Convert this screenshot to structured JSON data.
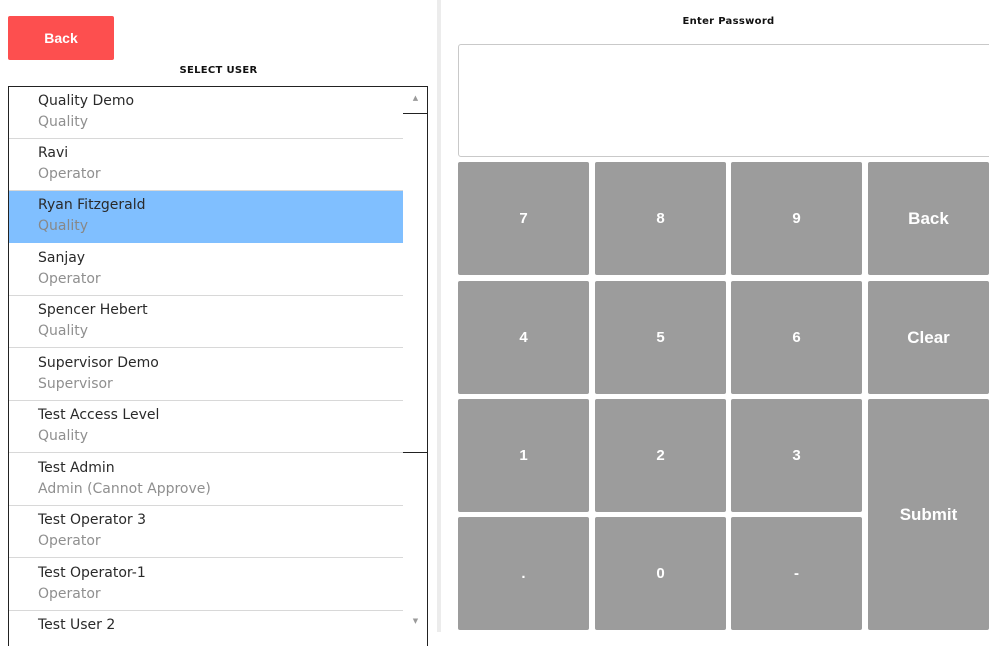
{
  "left_panel": {
    "back_label": "Back",
    "select_user_title": "SELECT USER",
    "users": [
      {
        "name": "Quality Demo",
        "role": "Quality"
      },
      {
        "name": "Ravi",
        "role": "Operator"
      },
      {
        "name": "Ryan Fitzgerald",
        "role": "Quality",
        "selected": true
      },
      {
        "name": "Sanjay",
        "role": "Operator"
      },
      {
        "name": "Spencer Hebert",
        "role": "Quality"
      },
      {
        "name": "Supervisor Demo",
        "role": "Supervisor"
      },
      {
        "name": "Test Access Level",
        "role": "Quality"
      },
      {
        "name": "Test Admin",
        "role": "Admin (Cannot Approve)"
      },
      {
        "name": "Test Operator 3",
        "role": "Operator"
      },
      {
        "name": "Test Operator-1",
        "role": "Operator"
      },
      {
        "name": "Test User 2",
        "role": ""
      }
    ],
    "scroll_up_icon": "▲",
    "scroll_down_icon": "▼"
  },
  "right_panel": {
    "password_title": "Enter Password",
    "password_value": "",
    "keys": {
      "k7": "7",
      "k8": "8",
      "k9": "9",
      "back": "Back",
      "k4": "4",
      "k5": "5",
      "k6": "6",
      "clear": "Clear",
      "k1": "1",
      "k2": "2",
      "k3": "3",
      "submit": "Submit",
      "dot": ".",
      "k0": "0",
      "dash": "-"
    }
  },
  "colors": {
    "back_button": "#fd4f4f",
    "selected_row": "#80bfff",
    "keypad_key": "#9c9c9c"
  }
}
